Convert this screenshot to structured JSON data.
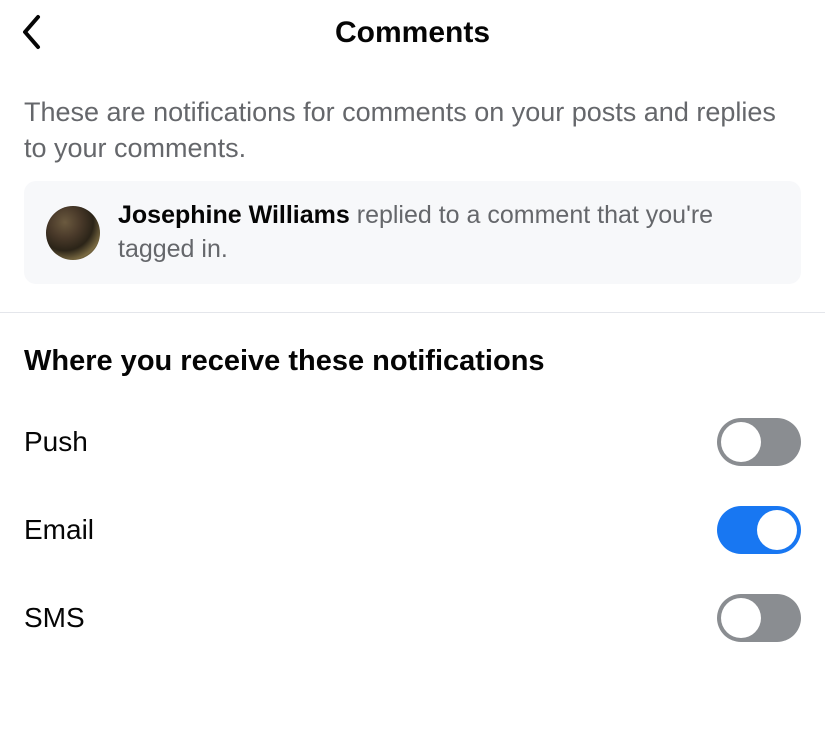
{
  "header": {
    "title": "Comments"
  },
  "description": "These are notifications for comments on your posts and replies to your comments.",
  "example": {
    "name": "Josephine Williams",
    "text_after_name": " replied to a comment that you're tagged in."
  },
  "section_title": "Where you receive these notifications",
  "toggles": [
    {
      "key": "push",
      "label": "Push",
      "enabled": false
    },
    {
      "key": "email",
      "label": "Email",
      "enabled": true
    },
    {
      "key": "sms",
      "label": "SMS",
      "enabled": false
    }
  ]
}
